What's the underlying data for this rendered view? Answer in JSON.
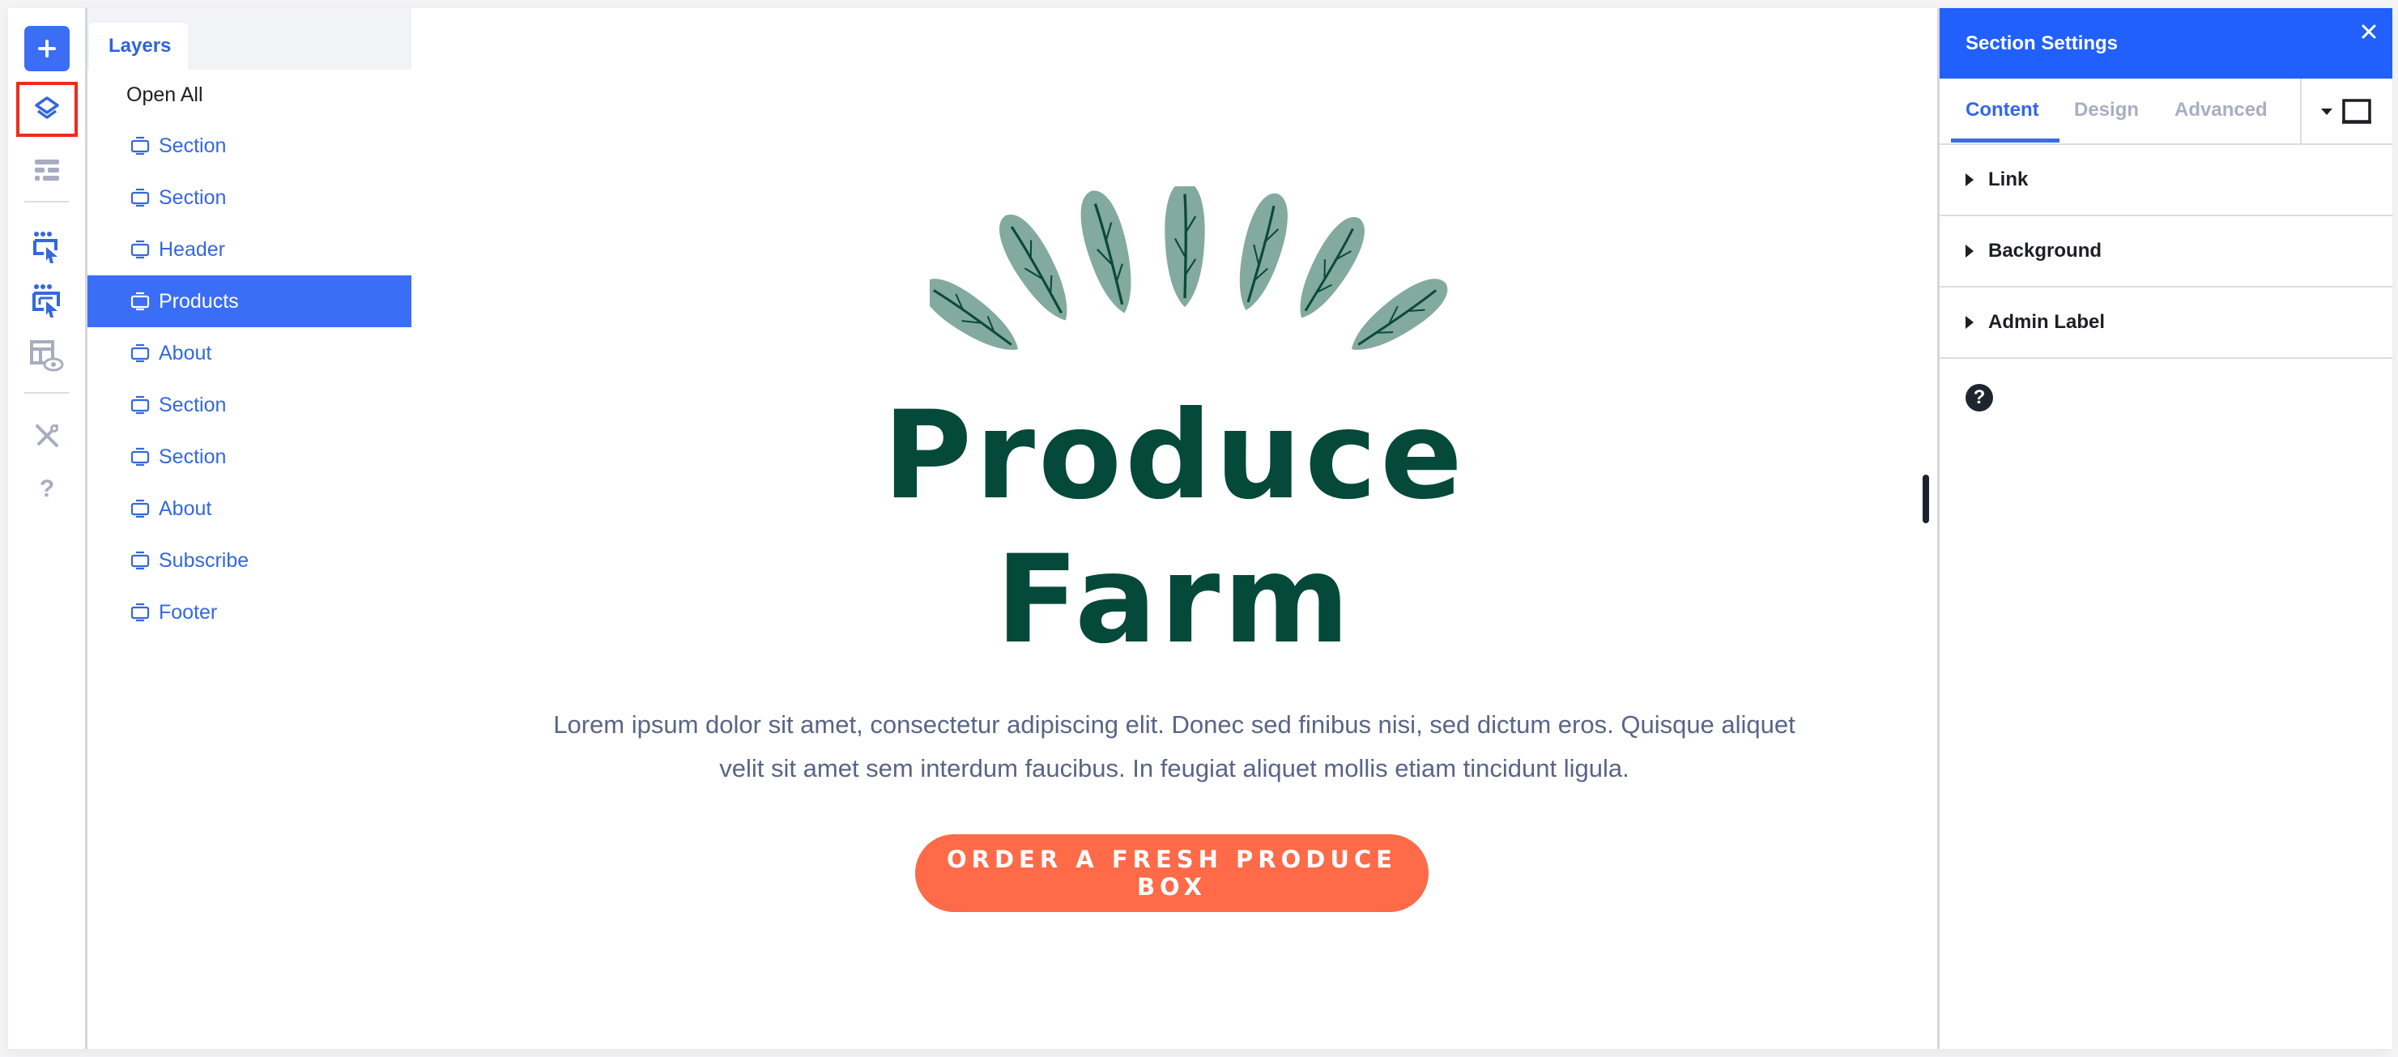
{
  "rail": {
    "items": [
      {
        "name": "add",
        "icon": "plus-icon"
      },
      {
        "name": "layers",
        "icon": "layers-icon",
        "active": true
      },
      {
        "name": "page-settings",
        "icon": "page-settings-icon"
      },
      {
        "name": "select-element",
        "icon": "select-element-icon"
      },
      {
        "name": "select-section",
        "icon": "select-section-icon"
      },
      {
        "name": "preview",
        "icon": "preview-icon"
      },
      {
        "name": "tools",
        "icon": "tools-icon"
      },
      {
        "name": "help",
        "icon": "help-icon",
        "label": "?"
      }
    ]
  },
  "layers": {
    "tab_label": "Layers",
    "open_all": "Open All",
    "items": [
      {
        "label": "Section"
      },
      {
        "label": "Section"
      },
      {
        "label": "Header"
      },
      {
        "label": "Products",
        "selected": true
      },
      {
        "label": "About"
      },
      {
        "label": "Section"
      },
      {
        "label": "Section"
      },
      {
        "label": "About"
      },
      {
        "label": "Subscribe"
      },
      {
        "label": "Footer"
      }
    ]
  },
  "canvas": {
    "headline_line1": "Produce",
    "headline_line2": "Farm",
    "body_text": "Lorem ipsum dolor sit amet, consectetur adipiscing elit. Donec sed finibus nisi, sed dictum eros. Quisque aliquet velit sit amet sem interdum faucibus. In feugiat aliquet mollis etiam tincidunt ligula.",
    "cta_label": "ORDER A FRESH PRODUCE BOX",
    "colors": {
      "headline": "#04493a",
      "cta": "#ff6a48",
      "leaf": "#83aa9e",
      "vein": "#0a4a3a"
    }
  },
  "settings": {
    "title": "Section Settings",
    "close_icon": "close-icon",
    "tabs": [
      {
        "label": "Content",
        "active": true
      },
      {
        "label": "Design"
      },
      {
        "label": "Advanced"
      }
    ],
    "device_icon": "desktop-icon",
    "accordions": [
      {
        "label": "Link"
      },
      {
        "label": "Background"
      },
      {
        "label": "Admin Label"
      }
    ],
    "help_label": "?"
  },
  "colors": {
    "accent": "#2160fd",
    "selected_row": "#3a6ef7",
    "active_outline": "#f02b1d",
    "link_text": "#3468dc"
  }
}
